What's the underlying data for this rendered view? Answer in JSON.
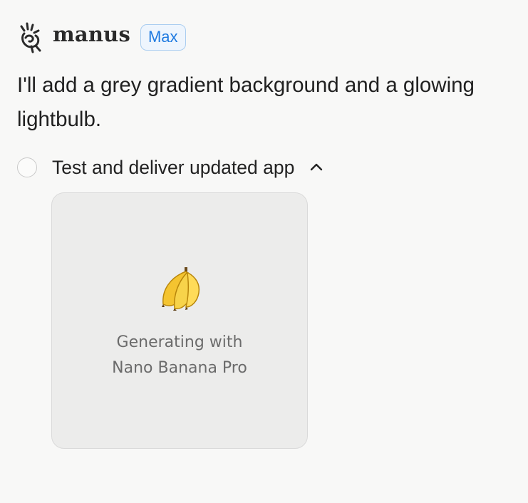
{
  "header": {
    "brand": "manus",
    "plan_badge": "Max",
    "logo_icon": "manus-hand-logo-icon"
  },
  "message": {
    "text": "I'll add a grey gradient background and a glowing lightbulb."
  },
  "task": {
    "label": "Test and deliver updated app",
    "status_icon": "empty-circle-icon",
    "toggle_icon": "chevron-up-icon"
  },
  "generation_card": {
    "icon": "banana-icon",
    "line1": "Generating with",
    "line2": "Nano Banana Pro"
  },
  "colors": {
    "background": "#f8f8f7",
    "badge_text": "#1f7ae0",
    "badge_border": "#a9cdf0",
    "card_bg": "#ececeb"
  }
}
